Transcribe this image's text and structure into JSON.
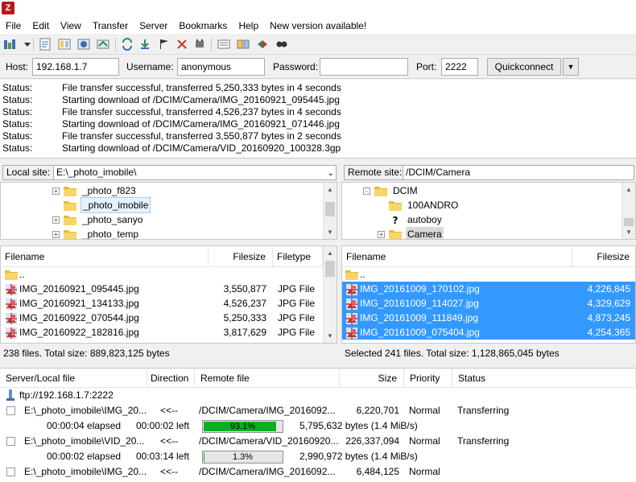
{
  "app": {
    "icon_letter": "Z"
  },
  "menubar": [
    {
      "label": "File",
      "name": "menu-file"
    },
    {
      "label": "Edit",
      "name": "menu-edit"
    },
    {
      "label": "View",
      "name": "menu-view"
    },
    {
      "label": "Transfer",
      "name": "menu-transfer"
    },
    {
      "label": "Server",
      "name": "menu-server"
    },
    {
      "label": "Bookmarks",
      "name": "menu-bookmarks"
    },
    {
      "label": "Help",
      "name": "menu-help"
    },
    {
      "label": "New version available!",
      "name": "menu-new-version"
    }
  ],
  "toolbar": {
    "icons": [
      "site-manager-icon",
      "dropdown-arrow-icon",
      "toggle-message-log-icon",
      "toggle-local-tree-icon",
      "toggle-remote-tree-icon",
      "toggle-queue-icon",
      "refresh-icon",
      "process-queue-icon",
      "cancel-operation-icon",
      "disconnect-icon",
      "reconnect-icon",
      "filename-filters-icon",
      "compare-directories-icon",
      "sync-browsing-icon",
      "search-files-icon"
    ]
  },
  "quickconnect": {
    "host_label": "Host:",
    "host_value": "192.168.1.7",
    "username_label": "Username:",
    "username_value": "anonymous",
    "password_label": "Password:",
    "password_value": "",
    "port_label": "Port:",
    "port_value": "2222",
    "button_label": "Quickconnect"
  },
  "log": [
    {
      "type": "Status:",
      "message": "File transfer successful, transferred 5,250,333 bytes in 4 seconds"
    },
    {
      "type": "Status:",
      "message": "Starting download of /DCIM/Camera/IMG_20160921_095445.jpg"
    },
    {
      "type": "Status:",
      "message": "File transfer successful, transferred 4,526,237 bytes in 4 seconds"
    },
    {
      "type": "Status:",
      "message": "Starting download of /DCIM/Camera/IMG_20160921_071446.jpg"
    },
    {
      "type": "Status:",
      "message": "File transfer successful, transferred 3,550,877 bytes in 2 seconds"
    },
    {
      "type": "Status:",
      "message": "Starting download of /DCIM/Camera/VID_20160920_100328.3gp"
    }
  ],
  "local": {
    "site_label": "Local site:",
    "path": "E:\\_photo_imobile\\",
    "tree": [
      {
        "label": "_photo_f823",
        "expander": "+"
      },
      {
        "label": "_photo_imobile",
        "expander": "",
        "selected": true
      },
      {
        "label": "_photo_sanyo",
        "expander": "+"
      },
      {
        "label": "_photo_temp",
        "expander": "+"
      }
    ],
    "columns": [
      "Filename",
      "Filesize",
      "Filetype"
    ],
    "files": [
      {
        "name": "..",
        "size": "",
        "type": ""
      },
      {
        "name": "IMG_20160921_095445.jpg",
        "size": "3,550,877",
        "type": "JPG File"
      },
      {
        "name": "IMG_20160921_134133.jpg",
        "size": "4,526,237",
        "type": "JPG File"
      },
      {
        "name": "IMG_20160922_070544.jpg",
        "size": "5,250,333",
        "type": "JPG File"
      },
      {
        "name": "IMG_20160922_182816.jpg",
        "size": "3,817,629",
        "type": "JPG File"
      }
    ],
    "status": "238 files. Total size: 889,823,125 bytes"
  },
  "remote": {
    "site_label": "Remote site:",
    "path": "/DCIM/Camera",
    "tree": [
      {
        "label": "DCIM",
        "expander": "-",
        "level": 0
      },
      {
        "label": "100ANDRO",
        "expander": "",
        "level": 1
      },
      {
        "label": "autoboy",
        "expander": "",
        "level": 1,
        "unknown": true
      },
      {
        "label": "Camera",
        "expander": "+",
        "level": 1,
        "selected": true
      }
    ],
    "columns": [
      "Filename",
      "Filesize"
    ],
    "files": [
      {
        "name": "..",
        "size": "",
        "selected": false
      },
      {
        "name": "IMG_20161009_170102.jpg",
        "size": "4,226,845",
        "selected": true
      },
      {
        "name": "IMG_20161009_114027.jpg",
        "size": "4,329,629",
        "selected": true
      },
      {
        "name": "IMG_20161009_111849.jpg",
        "size": "4,873,245",
        "selected": true
      },
      {
        "name": "IMG_20161009_075404.jpg",
        "size": "4,254,365",
        "selected": true
      }
    ],
    "status": "Selected 241 files. Total size: 1,128,865,045 bytes"
  },
  "queue": {
    "columns": [
      "Server/Local file",
      "Direction",
      "Remote file",
      "Size",
      "Priority",
      "Status"
    ],
    "server": "ftp://192.168.1.7:2222",
    "items": [
      {
        "local": "E:\\_photo_imobile\\IMG_20...",
        "direction": "<<--",
        "remote": "/DCIM/Camera/IMG_2016092...",
        "size": "6,220,701",
        "priority": "Normal",
        "status": "Transferring",
        "elapsed": "00:00:04 elapsed",
        "left": "00:00:02 left",
        "progress_percent": 93.1,
        "progress_label": "93.1%",
        "bytes": "5,795,632 bytes (1.4 MiB/s)"
      },
      {
        "local": "E:\\_photo_imobile\\VID_20...",
        "direction": "<<--",
        "remote": "/DCIM/Camera/VID_20160920...",
        "size": "226,337,094",
        "priority": "Normal",
        "status": "Transferring",
        "elapsed": "00:00:02 elapsed",
        "left": "00:03:14 left",
        "progress_percent": 1.3,
        "progress_label": "1.3%",
        "bytes": "2,990,972 bytes (1.4 MiB/s)"
      },
      {
        "local": "E:\\_photo_imobile\\IMG_20...",
        "direction": "<<--",
        "remote": "/DCIM/Camera/IMG_2016092...",
        "size": "6,484,125",
        "priority": "Normal",
        "status": ""
      }
    ]
  },
  "colors": {
    "selection_blue": "#3399ff",
    "progress_green": "#06b025",
    "app_icon_red": "#b31b1b"
  }
}
